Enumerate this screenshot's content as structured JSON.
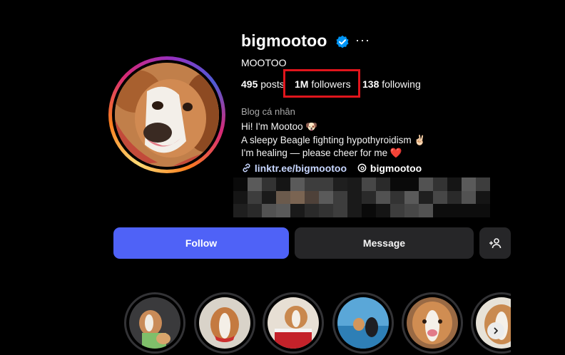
{
  "profile": {
    "username": "bigmootoo",
    "more_label": "···",
    "full_name": "MOOTOO",
    "stats": {
      "posts_count": "495",
      "posts_label": "posts",
      "followers_count": "1M",
      "followers_label": "followers",
      "following_count": "138",
      "following_label": "following"
    },
    "category": "Blog cá nhân",
    "bio": [
      "Hi! I'm Mootoo 🐶",
      "A sleepy Beagle fighting hypothyroidism ✌🏻",
      "I'm healing — please cheer for me ❤️"
    ],
    "link_text": "linktr.ee/bigmootoo",
    "threads_handle": "bigmootoo"
  },
  "actions": {
    "follow_label": "Follow",
    "message_label": "Message",
    "suggest_icon": "add-person-icon"
  },
  "highlights": {
    "count_visible": 6,
    "next_icon": "chevron-right-icon"
  },
  "colors": {
    "background": "#000000",
    "follow_button": "#4f62f7",
    "secondary_button": "#262628",
    "verified_badge": "#0095f6",
    "highlight_annotation": "#e0151c",
    "muted_text": "#a8a8a8"
  }
}
